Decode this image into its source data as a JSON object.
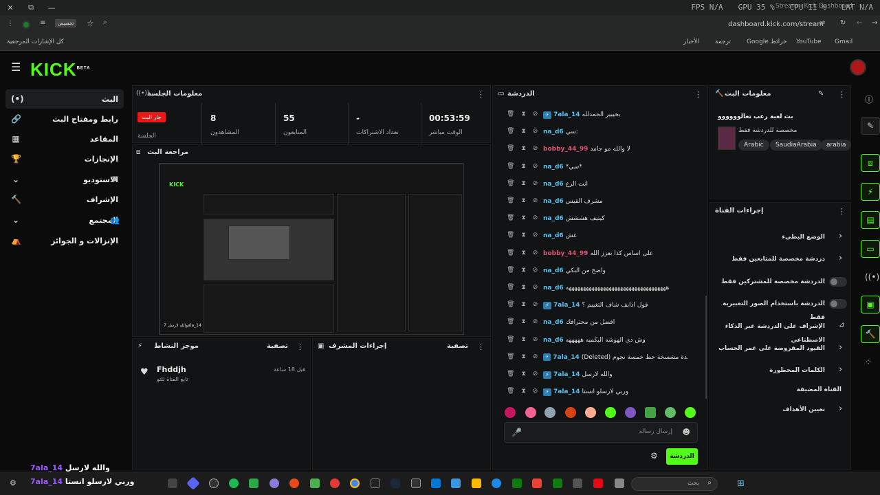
{
  "titlebar": {
    "close": "✕",
    "restore": "⧉",
    "minimize": "—",
    "fps": "FPS N/A",
    "gpu": "GPU 35 %",
    "cpu": "CPU 11 %",
    "lat": "LAT N/A",
    "tab_title": "Stream - Kick Dashboard"
  },
  "address": {
    "url": "dashboard.kick.com/stream",
    "tooltip": "تخصيص"
  },
  "bookmarks": {
    "items": [
      "Gmail",
      "YouTube",
      "Google خرائط",
      "ترجمة",
      "الأخبار"
    ],
    "all": "كل الإشارات المرجعية"
  },
  "app": {
    "logo": "KICK",
    "logo_badge": "BETA"
  },
  "sidebar": {
    "items": [
      {
        "label": "البث",
        "icon": "(•)",
        "active": true
      },
      {
        "label": "رابط ومفتاح البث",
        "icon": "🔗"
      },
      {
        "label": "المقاعد",
        "icon": "▦"
      },
      {
        "label": "الإنجازات",
        "icon": "🏆"
      },
      {
        "label": "الاستوديو",
        "icon": "⌄"
      },
      {
        "label": "الإشراف",
        "icon": "🔨"
      },
      {
        "label": "المجتمع",
        "icon": "⌄"
      },
      {
        "label": "الإنزالات و الجوائز",
        "icon": "⛺"
      }
    ]
  },
  "session": {
    "title": "معلومات الجلسة",
    "live_badge": "جار البث",
    "session_lbl": "الجلسة",
    "stats": [
      {
        "value": "8",
        "label": "المشاهدون"
      },
      {
        "value": "55",
        "label": "المتابعون"
      },
      {
        "value": "-",
        "label": "تعداد الاشتراكات"
      },
      {
        "value": "00:53:59",
        "label": "الوقت مباشر"
      }
    ]
  },
  "review": {
    "title": "مراجعة البث",
    "preview_caption": "والله لارسل 7ala_14"
  },
  "activity": {
    "title": "موجز النشاط",
    "filter": "تصفية",
    "item_name": "Fhddjh",
    "item_sub": "تابع القناة للتو",
    "item_time": "قبل 18 ساعة"
  },
  "modactions": {
    "title": "إجراءات المشرف",
    "filter": "تصفية"
  },
  "chat": {
    "title": "الدردشة",
    "input_placeholder": "إرسال رسالة",
    "send": "الدردشة",
    "messages": [
      {
        "user": "7ala_14",
        "color": "#53c3f2",
        "msg": "بخيبير الحمدلله",
        "badge": true
      },
      {
        "user": "na_d6",
        "color": "#53c3f2",
        "msg": "سي:",
        "badge": false
      },
      {
        "user": "bobby_44_99",
        "color": "#e0537a",
        "msg": "لا والله مو جامد",
        "badge": false
      },
      {
        "user": "na_d6",
        "color": "#53c3f2",
        "msg": "*سي*",
        "badge": false
      },
      {
        "user": "na_d6",
        "color": "#53c3f2",
        "msg": "انت الرع",
        "badge": false
      },
      {
        "user": "na_d6",
        "color": "#53c3f2",
        "msg": "مشرف القيس",
        "badge": false
      },
      {
        "user": "na_d6",
        "color": "#53c3f2",
        "msg": "كيتيف هششش",
        "badge": false
      },
      {
        "user": "na_d6",
        "color": "#53c3f2",
        "msg": "غش",
        "badge": false
      },
      {
        "user": "bobby_44_99",
        "color": "#e0537a",
        "msg": "على اساس كذا تعزز الله",
        "badge": false
      },
      {
        "user": "na_d6",
        "color": "#53c3f2",
        "msg": "واضح من البكي",
        "badge": false
      },
      {
        "user": "na_d6",
        "color": "#53c3f2",
        "msg": "هههههههههههههههههههههههههههههههههههه",
        "badge": false
      },
      {
        "user": "7ala_14",
        "color": "#53c3f2",
        "msg": "قول اذايف شاف التغييم ؟",
        "badge": true
      },
      {
        "user": "na_d6",
        "color": "#53c3f2",
        "msg": "افضل من محترافك",
        "badge": false
      },
      {
        "user": "na_d6",
        "color": "#53c3f2",
        "msg": "وش ذي الهوشه البكميه هههههه",
        "badge": false
      },
      {
        "user": "7ala_14",
        "color": "#53c3f2",
        "msg": "(Deleted) وحدة مشسخة حط خمسة نجوم",
        "badge": true
      },
      {
        "user": "7ala_14",
        "color": "#53c3f2",
        "msg": "والله لارسل",
        "badge": true
      },
      {
        "user": "7ala_14",
        "color": "#53c3f2",
        "msg": "وربي لارسلو انستا",
        "badge": true
      }
    ]
  },
  "streaminfo": {
    "title": "معلومات البث",
    "stream_title": "بث لعبة رعب تعالوووووو",
    "subtitle": "مخصصة للدردشة فقط",
    "tags": [
      "arabia",
      "SaudiaArabia",
      "Arabic"
    ]
  },
  "channel": {
    "title": "إجراءات القناة",
    "settings": [
      {
        "label": "الوضع البطيء",
        "type": "chevron"
      },
      {
        "label": "دردشة مخصصة للمتابعين فقط",
        "type": "chevron"
      },
      {
        "label": "الدردشة مخصصة للمشتركين فقط",
        "type": "toggle"
      },
      {
        "label": "الدردشة باستخدام الصور التعبيرية فقط",
        "type": "toggle"
      },
      {
        "label": "الإشراف على الدردشة عبر الذكاء الاصطناعي",
        "type": "icon"
      },
      {
        "label": "القيود المفروضة على عمر الحساب",
        "type": "chevron"
      },
      {
        "label": "الكلمات المحظورة",
        "type": "chevron"
      },
      {
        "label": "القناة المضيفة",
        "type": "none"
      },
      {
        "label": "تعيين الأهداف",
        "type": "chevron"
      }
    ]
  },
  "overlay": {
    "line1_user": "7ala_14",
    "line1_msg": "والله لارسل",
    "line2_user": "7ala_14",
    "line2_msg": "وربي لارسلو انستا"
  },
  "taskbar": {
    "search": "بحث"
  }
}
